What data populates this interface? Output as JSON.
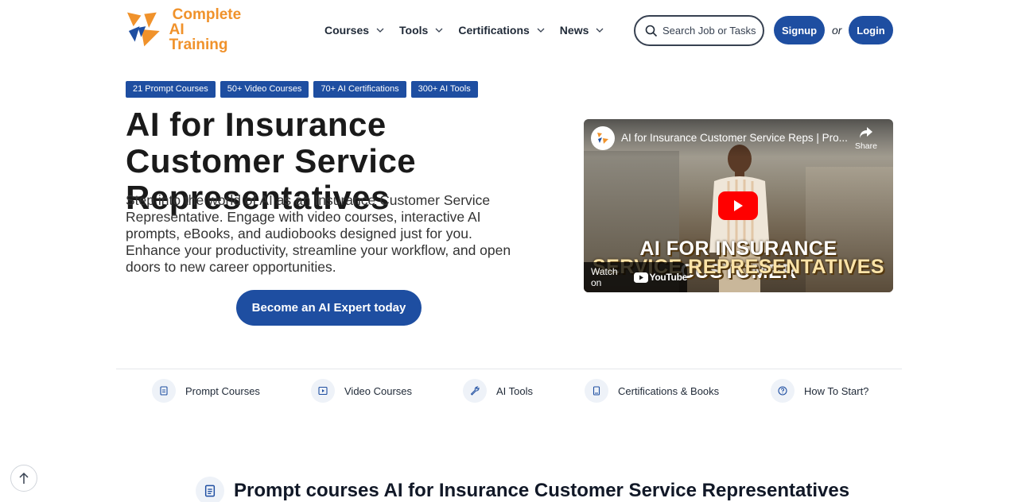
{
  "brand": {
    "line1": "Complete",
    "line2": "AI Training"
  },
  "nav": {
    "items": [
      {
        "label": "Courses"
      },
      {
        "label": "Tools"
      },
      {
        "label": "Certifications"
      },
      {
        "label": "News"
      }
    ],
    "search_placeholder": "Search Job or Tasks",
    "signup_label": "Signup",
    "or_label": "or",
    "login_label": "Login"
  },
  "tags": [
    {
      "label": "21 Prompt Courses"
    },
    {
      "label": "50+ Video Courses"
    },
    {
      "label": "70+ AI Certifications"
    },
    {
      "label": "300+ AI Tools"
    }
  ],
  "hero": {
    "title": "AI for Insurance Customer Service Representatives",
    "description": "Step into the world of AI as an Insurance Customer Service Representative. Engage with video courses, interactive AI prompts, eBooks, and audiobooks designed just for you. Enhance your productivity, streamline your workflow, and open doors to new career opportunities.",
    "cta_label": "Become an AI Expert today"
  },
  "video": {
    "title": "AI for Insurance Customer Service Reps | Pro...",
    "share_label": "Share",
    "overlay_line1": "AI FOR INSURANCE CUSTOMER",
    "overlay_line2": "SERVICE REPRESENTATIVES",
    "watch_on_label": "Watch on",
    "platform_label": "YouTube"
  },
  "categories": [
    {
      "label": "Prompt Courses",
      "icon": "document-icon"
    },
    {
      "label": "Video Courses",
      "icon": "play-icon"
    },
    {
      "label": "AI Tools",
      "icon": "wrench-icon"
    },
    {
      "label": "Certifications & Books",
      "icon": "book-icon"
    },
    {
      "label": "How To Start?",
      "icon": "question-icon"
    }
  ],
  "section": {
    "title": "Prompt courses AI for Insurance Customer Service Representatives"
  },
  "colors": {
    "brand_blue": "#1e4ea1",
    "brand_orange": "#f0922b",
    "youtube_red": "#ff0000"
  }
}
